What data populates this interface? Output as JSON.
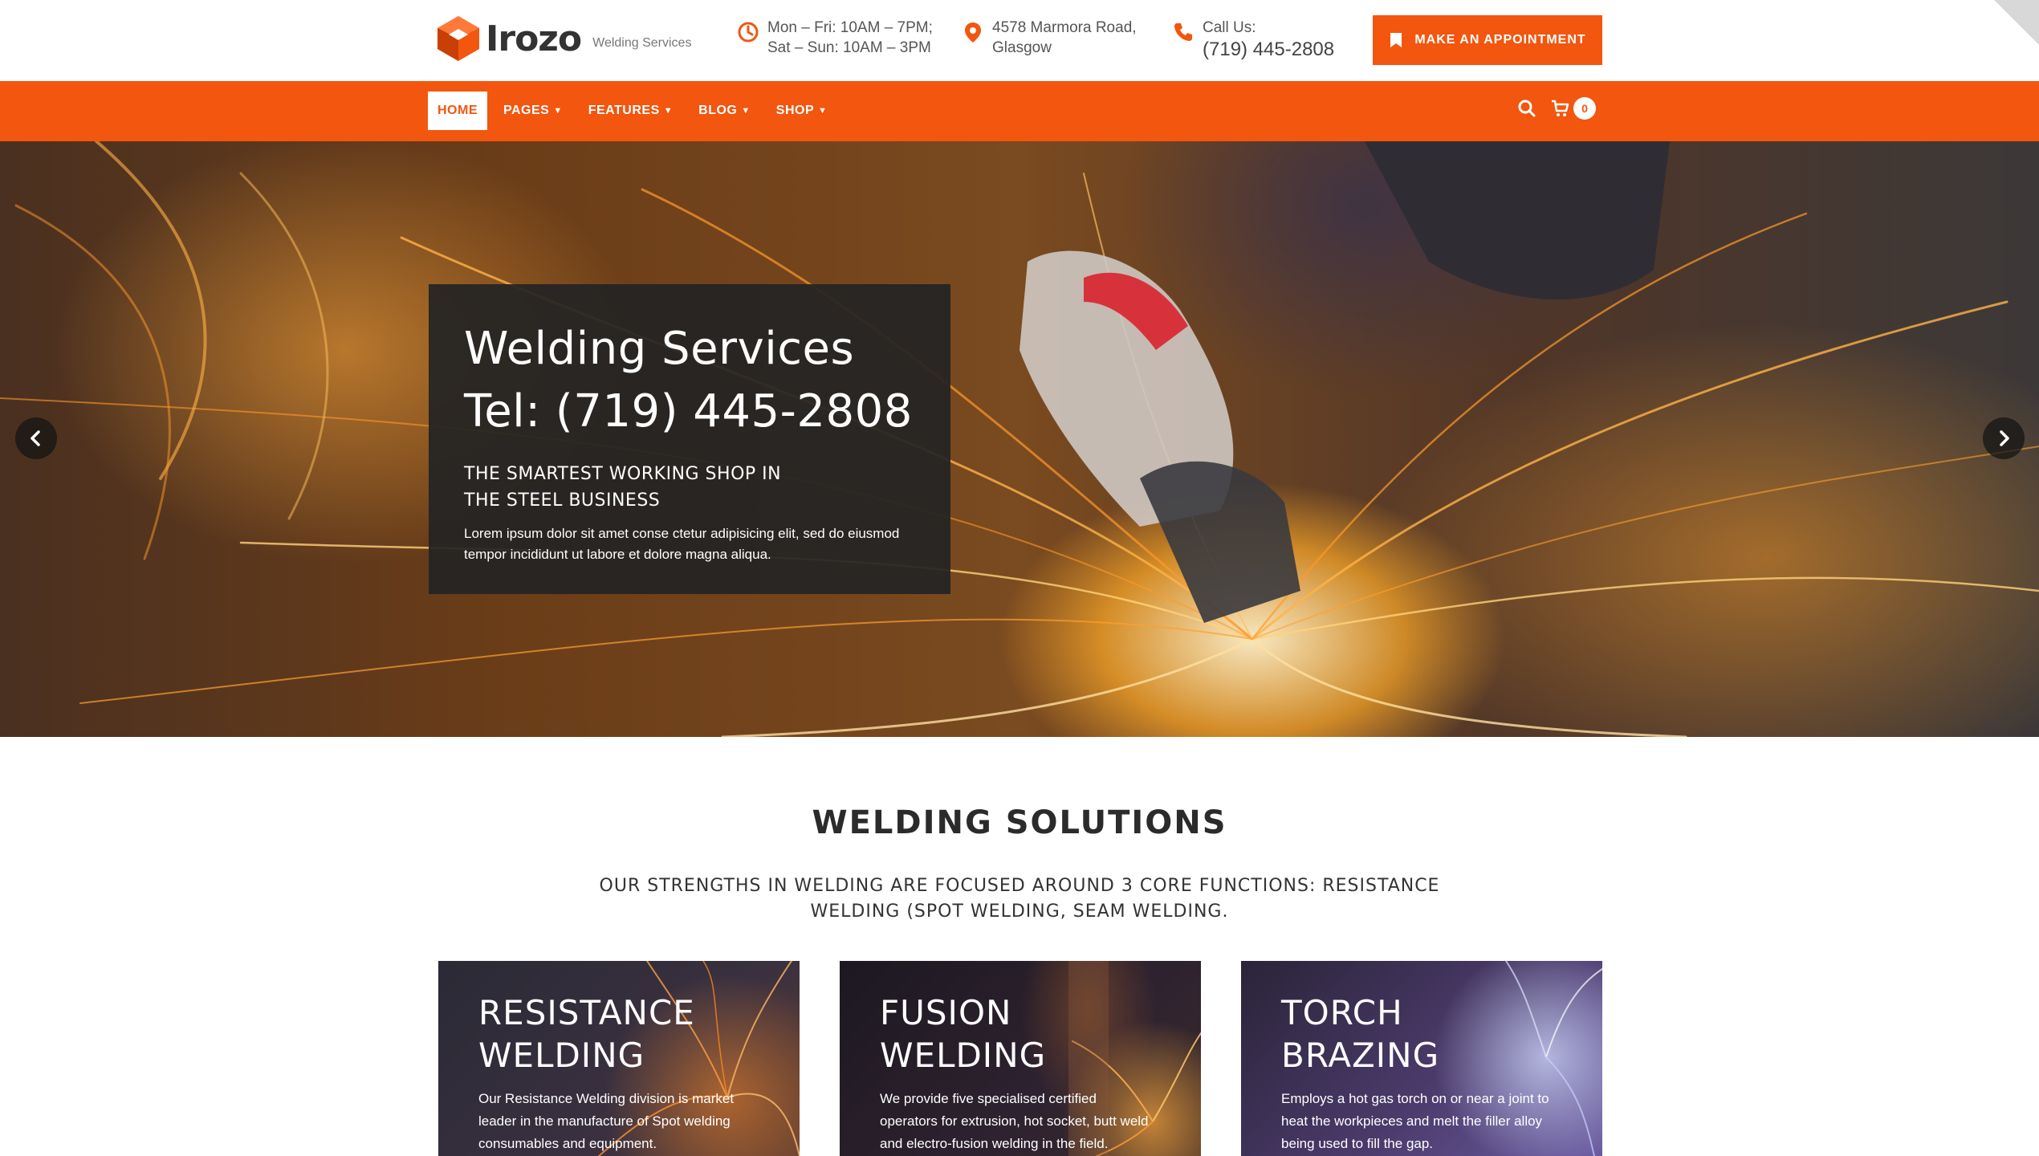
{
  "brand": {
    "name": "Irozo",
    "tagline": "Welding Services",
    "accent": "#f2560f"
  },
  "header": {
    "hours": {
      "line1": "Mon – Fri: 10AM – 7PM;",
      "line2": "Sat – Sun: 10AM – 3PM",
      "icon": "clock-icon"
    },
    "address": {
      "line1": "4578 Marmora Road,",
      "line2": "Glasgow",
      "icon": "map-pin-icon"
    },
    "call": {
      "label": "Call Us:",
      "phone": "(719) 445-2808",
      "icon": "phone-icon"
    },
    "appointment_label": "MAKE AN APPOINTMENT"
  },
  "nav": {
    "items": [
      {
        "label": "HOME",
        "active": true
      },
      {
        "label": "PAGES",
        "dropdown": true
      },
      {
        "label": "FEATURES",
        "dropdown": true
      },
      {
        "label": "BLOG",
        "dropdown": true
      },
      {
        "label": "SHOP",
        "dropdown": true
      }
    ],
    "cart_count": "0"
  },
  "hero": {
    "title_line1": "Welding Services",
    "title_line2": "Tel: (719) 445-2808",
    "subtitle_line1": "THE SMARTEST WORKING SHOP IN",
    "subtitle_line2": "THE STEEL BUSINESS",
    "body": "Lorem ipsum dolor sit amet conse ctetur adipisicing elit, sed do eiusmod tempor incididunt ut labore et dolore magna aliqua."
  },
  "solutions": {
    "title": "WELDING SOLUTIONS",
    "subtitle": "OUR STRENGTHS IN WELDING ARE FOCUSED AROUND 3 CORE FUNCTIONS: RESISTANCE WELDING (SPOT WELDING, SEAM WELDING.",
    "cards": [
      {
        "title_line1": "RESISTANCE",
        "title_line2": "WELDING",
        "body": "Our Resistance Welding division is market leader in the manufacture of Spot welding consumables and equipment."
      },
      {
        "title_line1": "FUSION",
        "title_line2": "WELDING",
        "body": "We provide five specialised certified operators for extrusion, hot socket, butt weld and electro-fusion welding in the field."
      },
      {
        "title_line1": "TORCH",
        "title_line2": "BRAZING",
        "body": "Employs a hot gas torch on or near a joint to heat the workpieces and melt the filler alloy being used to fill the gap."
      }
    ]
  }
}
